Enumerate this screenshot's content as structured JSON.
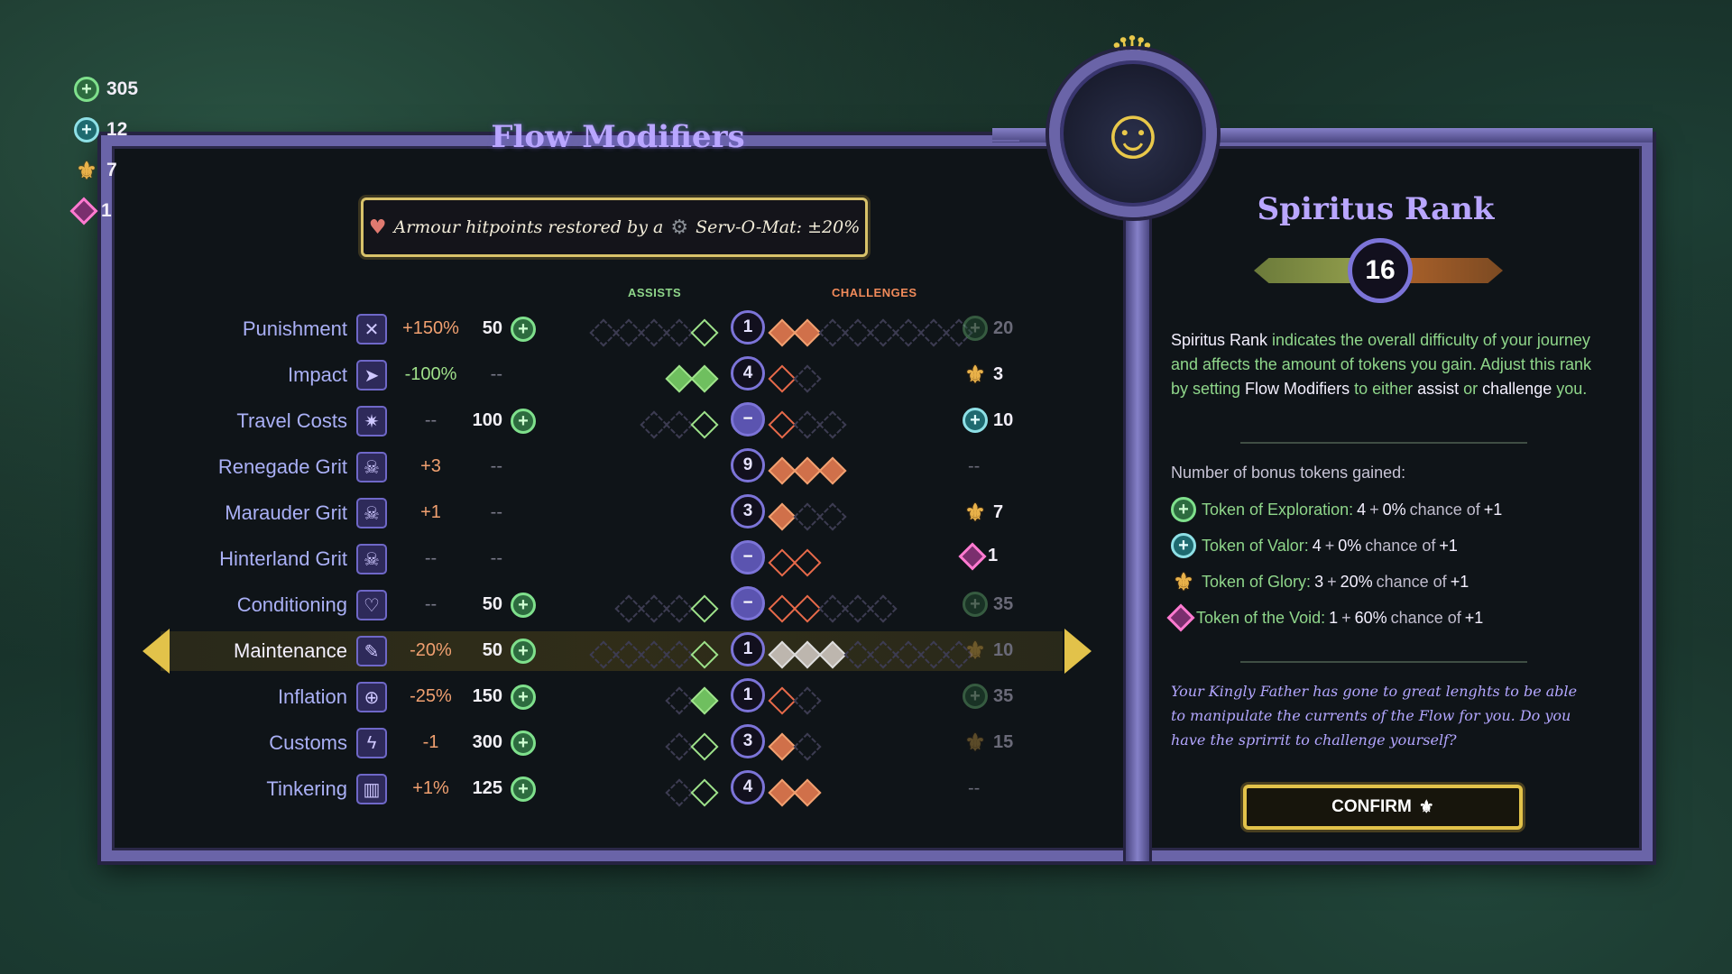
{
  "currencies": [
    {
      "icon": "token-exploration-icon",
      "value": "305"
    },
    {
      "icon": "token-valor-icon",
      "value": "12"
    },
    {
      "icon": "token-glory-icon",
      "value": "7"
    },
    {
      "icon": "token-void-icon",
      "value": "1"
    }
  ],
  "panel_title": "Flow Modifiers",
  "tooltip": {
    "text_before": "Armour hitpoints restored by a",
    "item": "Serv-O-Mat",
    "text_after": ": ±20%"
  },
  "headers": {
    "assists": "ASSISTS",
    "challenges": "CHALLENGES"
  },
  "modifiers": [
    {
      "name": "Punishment",
      "icon": "crossed-swords-icon",
      "glyph": "✕",
      "pct": "+150%",
      "pct_kind": "pos",
      "cost": "50",
      "center": "1",
      "assists": [
        0,
        0,
        0,
        0,
        1
      ],
      "challenges": [
        2,
        2,
        0,
        0,
        0,
        0,
        0,
        0
      ],
      "reward": "20",
      "reward_icon": "token-exploration-icon",
      "reward_dim": true
    },
    {
      "name": "Impact",
      "icon": "arrow-impact-icon",
      "glyph": "➤",
      "pct": "-100%",
      "pct_kind": "neg",
      "cost": "--",
      "center": "4",
      "assists": [
        2,
        2
      ],
      "challenges": [
        1,
        0
      ],
      "reward": "3",
      "reward_icon": "token-glory-icon",
      "reward_dim": false
    },
    {
      "name": "Travel Costs",
      "icon": "compass-icon",
      "glyph": "✷",
      "pct": "--",
      "pct_kind": "none",
      "cost": "100",
      "center": "-",
      "assists": [
        0,
        0,
        1
      ],
      "challenges": [
        1,
        0,
        0
      ],
      "reward": "10",
      "reward_icon": "token-valor-icon",
      "reward_dim": false
    },
    {
      "name": "Renegade Grit",
      "icon": "skull-icon",
      "glyph": "☠",
      "pct": "+3",
      "pct_kind": "pos",
      "cost": "--",
      "center": "9",
      "assists": [],
      "challenges": [
        2,
        2,
        2
      ],
      "reward": "--",
      "reward_icon": "",
      "reward_dim": true
    },
    {
      "name": "Marauder Grit",
      "icon": "skull-icon",
      "glyph": "☠",
      "pct": "+1",
      "pct_kind": "pos",
      "cost": "--",
      "center": "3",
      "assists": [],
      "challenges": [
        2,
        0,
        0
      ],
      "reward": "7",
      "reward_icon": "token-glory-icon",
      "reward_dim": false
    },
    {
      "name": "Hinterland Grit",
      "icon": "skull-icon",
      "glyph": "☠",
      "pct": "--",
      "pct_kind": "none",
      "cost": "--",
      "center": "-",
      "assists": [],
      "challenges": [
        1,
        1
      ],
      "reward": "1",
      "reward_icon": "token-void-icon",
      "reward_dim": false
    },
    {
      "name": "Conditioning",
      "icon": "heart-shield-icon",
      "glyph": "♡",
      "pct": "--",
      "pct_kind": "none",
      "cost": "50",
      "center": "-",
      "assists": [
        0,
        0,
        0,
        1
      ],
      "challenges": [
        1,
        1,
        0,
        0,
        0
      ],
      "reward": "35",
      "reward_icon": "token-exploration-icon",
      "reward_dim": true
    },
    {
      "name": "Maintenance",
      "icon": "wrench-icon",
      "glyph": "✎",
      "pct": "-20%",
      "pct_kind": "pos",
      "cost": "50",
      "center": "1",
      "assists": [
        0,
        0,
        0,
        0,
        1
      ],
      "challenges": [
        3,
        3,
        3,
        0,
        0,
        0,
        0,
        0
      ],
      "reward": "10",
      "reward_icon": "token-glory-icon",
      "reward_dim": true,
      "selected": true
    },
    {
      "name": "Inflation",
      "icon": "coin-icon",
      "glyph": "⊕",
      "pct": "-25%",
      "pct_kind": "pos",
      "cost": "150",
      "center": "1",
      "assists": [
        0,
        2
      ],
      "challenges": [
        1,
        0
      ],
      "reward": "35",
      "reward_icon": "token-exploration-icon",
      "reward_dim": true
    },
    {
      "name": "Customs",
      "icon": "lightning-icon",
      "glyph": "ϟ",
      "pct": "-1",
      "pct_kind": "pos",
      "cost": "300",
      "center": "3",
      "assists": [
        0,
        1
      ],
      "challenges": [
        2,
        0
      ],
      "reward": "15",
      "reward_icon": "token-glory-icon",
      "reward_dim": true
    },
    {
      "name": "Tinkering",
      "icon": "gauge-icon",
      "glyph": "▥",
      "pct": "+1%",
      "pct_kind": "pos",
      "cost": "125",
      "center": "4",
      "assists": [
        0,
        1
      ],
      "challenges": [
        2,
        2
      ],
      "reward": "--",
      "reward_icon": "",
      "reward_dim": true
    }
  ],
  "rank": {
    "title": "Spiritus Rank",
    "value": "16",
    "desc_1a": "Spiritus Rank",
    "desc_1b": " indicates the overall difficulty of your journey and affects the amount of tokens you gain. Adjust this rank by setting ",
    "desc_1c": "Flow Modifiers",
    "desc_1d": " to either ",
    "desc_1e": "assist",
    "desc_1f": " or ",
    "desc_1g": "challenge",
    "desc_1h": " you."
  },
  "bonus_header": "Number of bonus tokens gained:",
  "bonuses": [
    {
      "icon": "token-exploration-icon",
      "label": "Token of Exploration:",
      "base": "4",
      "plus": "+",
      "pct": "0%",
      "chance": "chance of",
      "inc": "+1"
    },
    {
      "icon": "token-valor-icon",
      "label": "Token of Valor:",
      "base": "4",
      "plus": "+",
      "pct": "0%",
      "chance": "chance of",
      "inc": "+1"
    },
    {
      "icon": "token-glory-icon",
      "label": "Token of Glory:",
      "base": "3",
      "plus": "+",
      "pct": "20%",
      "chance": "chance of",
      "inc": "+1"
    },
    {
      "icon": "token-void-icon",
      "label": "Token of the Void:",
      "base": "1",
      "plus": "+",
      "pct": "60%",
      "chance": "chance of",
      "inc": "+1"
    }
  ],
  "quote": "Your Kingly Father has gone to great lenghts to be able to manipulate the currents of the Flow for you. Do you have the sprirrit to challenge yourself?",
  "confirm_label": "CONFIRM",
  "colors": {
    "frame": "#6a64a8",
    "assist": "#9ee28a",
    "challenge": "#f0a070",
    "gold": "#e2c24a",
    "title": "#b9a6ff"
  }
}
